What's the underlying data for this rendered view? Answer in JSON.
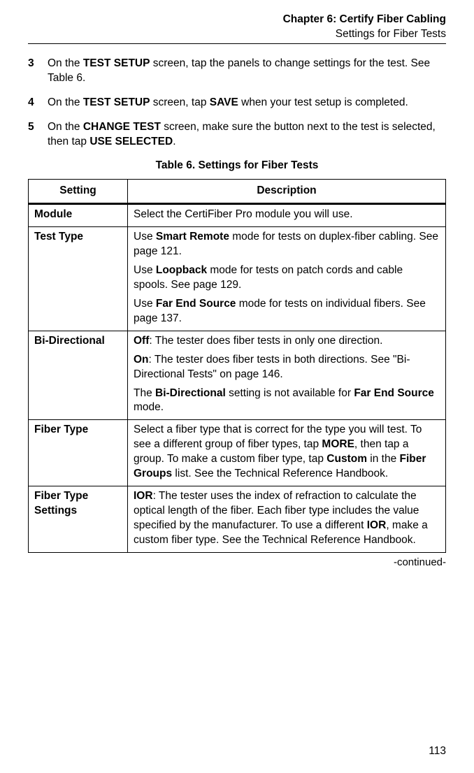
{
  "header": {
    "chapter": "Chapter 6: Certify Fiber Cabling",
    "section": "Settings for Fiber Tests"
  },
  "steps": [
    {
      "num": "3",
      "html": "On the <b>TEST SETUP</b> screen, tap the panels to change settings for the test. See Table 6."
    },
    {
      "num": "4",
      "html": "On the <b>TEST SETUP</b> screen, tap <b>SAVE</b> when your test setup is completed."
    },
    {
      "num": "5",
      "html": "On the <b>CHANGE TEST</b> screen, make sure the button next to the test is selected, then tap <b>USE SELECTED</b>."
    }
  ],
  "table_caption": "Table 6. Settings for Fiber Tests",
  "columns": {
    "setting": "Setting",
    "description": "Description"
  },
  "rows": [
    {
      "setting": "Module",
      "desc": [
        "Select the CertiFiber Pro module you will use."
      ]
    },
    {
      "setting": "Test Type",
      "desc": [
        "Use <b>Smart Remote</b> mode for tests on duplex-fiber cabling. See page 121.",
        "Use <b>Loopback</b> mode for tests on patch cords and cable spools. See page 129.",
        "Use <b>Far End Source</b> mode for tests on individual fibers. See page 137."
      ]
    },
    {
      "setting": "Bi-Directional",
      "desc": [
        "<b>Off</b>: The tester does fiber tests in only one direction.",
        "<b>On</b>: The tester does fiber tests in both directions. See \"Bi-Directional Tests\" on page 146.",
        "The <b>Bi-Directional</b> setting is not available for <b>Far End Source</b> mode."
      ]
    },
    {
      "setting": "Fiber Type",
      "desc": [
        "Select a fiber type that is correct for the type you will test. To see a different group of fiber types, tap <b>MORE</b>, then tap a group. To make a custom fiber type, tap <b>Custom</b> in the <b>Fiber Groups</b> list. See the Technical Reference Handbook."
      ]
    },
    {
      "setting": "Fiber Type Settings",
      "desc": [
        "<b>IOR</b>: The tester uses the index of refraction to calculate the optical length of the fiber. Each fiber type includes the value specified by the manufacturer. To use a different <b>IOR</b>, make a custom fiber type. See the Technical Reference Handbook."
      ]
    }
  ],
  "continued": "-continued-",
  "pagenum": "113"
}
